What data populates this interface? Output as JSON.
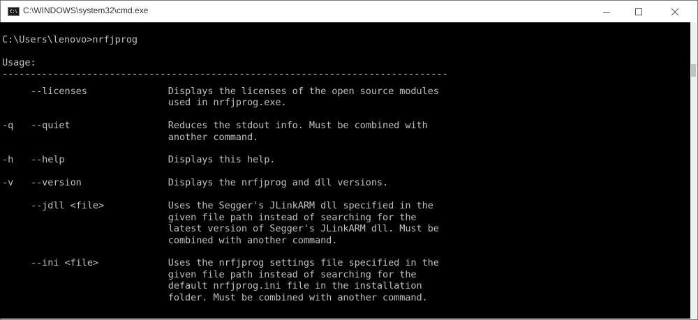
{
  "window": {
    "title": "C:\\WINDOWS\\system32\\cmd.exe",
    "icon": "console-icon"
  },
  "controls": {
    "minimize": "minimize-icon",
    "maximize": "maximize-icon",
    "close": "close-icon"
  },
  "terminal": {
    "prompt": "C:\\Users\\lenovo>nrfjprog",
    "usage": "Usage:",
    "separator": "-------------------------------------------------------------------------------",
    "options": [
      {
        "short": "",
        "long": "--licenses",
        "description": [
          "Displays the licenses of the open source modules",
          "used in nrfjprog.exe."
        ]
      },
      {
        "short": "-q",
        "long": "--quiet",
        "description": [
          "Reduces the stdout info. Must be combined with",
          "another command."
        ]
      },
      {
        "short": "-h",
        "long": "--help",
        "description": [
          "Displays this help."
        ]
      },
      {
        "short": "-v",
        "long": "--version",
        "description": [
          "Displays the nrfjprog and dll versions."
        ]
      },
      {
        "short": "",
        "long": "--jdll <file>",
        "description": [
          "Uses the Segger's JLinkARM dll specified in the",
          "given file path instead of searching for the",
          "latest version of Segger's JLinkARM dll. Must be",
          "combined with another command."
        ]
      },
      {
        "short": "",
        "long": "--ini <file>",
        "description": [
          "Uses the nrfjprog settings file specified in the",
          "given file path instead of searching for the",
          "default nrfjprog.ini file in the installation",
          "folder. Must be combined with another command."
        ]
      }
    ]
  },
  "colors": {
    "background": "#000000",
    "text": "#c0c0c0"
  }
}
